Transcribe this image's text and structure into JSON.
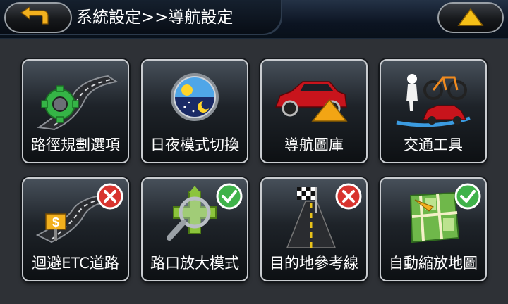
{
  "header": {
    "title": "系統設定>>導航設定",
    "back_icon": "back-arrow-icon",
    "up_icon": "up-triangle-icon"
  },
  "colors": {
    "accent_yellow": "#f2b01e",
    "check_green": "#3fb24a",
    "cross_red": "#d8342f"
  },
  "tiles": [
    {
      "label": "路徑規劃選項",
      "icon": "route-gear-icon"
    },
    {
      "label": "日夜模式切換",
      "icon": "day-night-icon"
    },
    {
      "label": "導航圖庫",
      "icon": "car-arrow-icon"
    },
    {
      "label": "交通工具",
      "icon": "vehicles-icon"
    },
    {
      "label": "迴避ETC道路",
      "icon": "toll-road-icon",
      "status": "off"
    },
    {
      "label": "路口放大模式",
      "icon": "junction-zoom-icon",
      "status": "on"
    },
    {
      "label": "目的地參考線",
      "icon": "destination-line-icon",
      "status": "off"
    },
    {
      "label": "自動縮放地圖",
      "icon": "auto-zoom-map-icon",
      "status": "on"
    }
  ]
}
